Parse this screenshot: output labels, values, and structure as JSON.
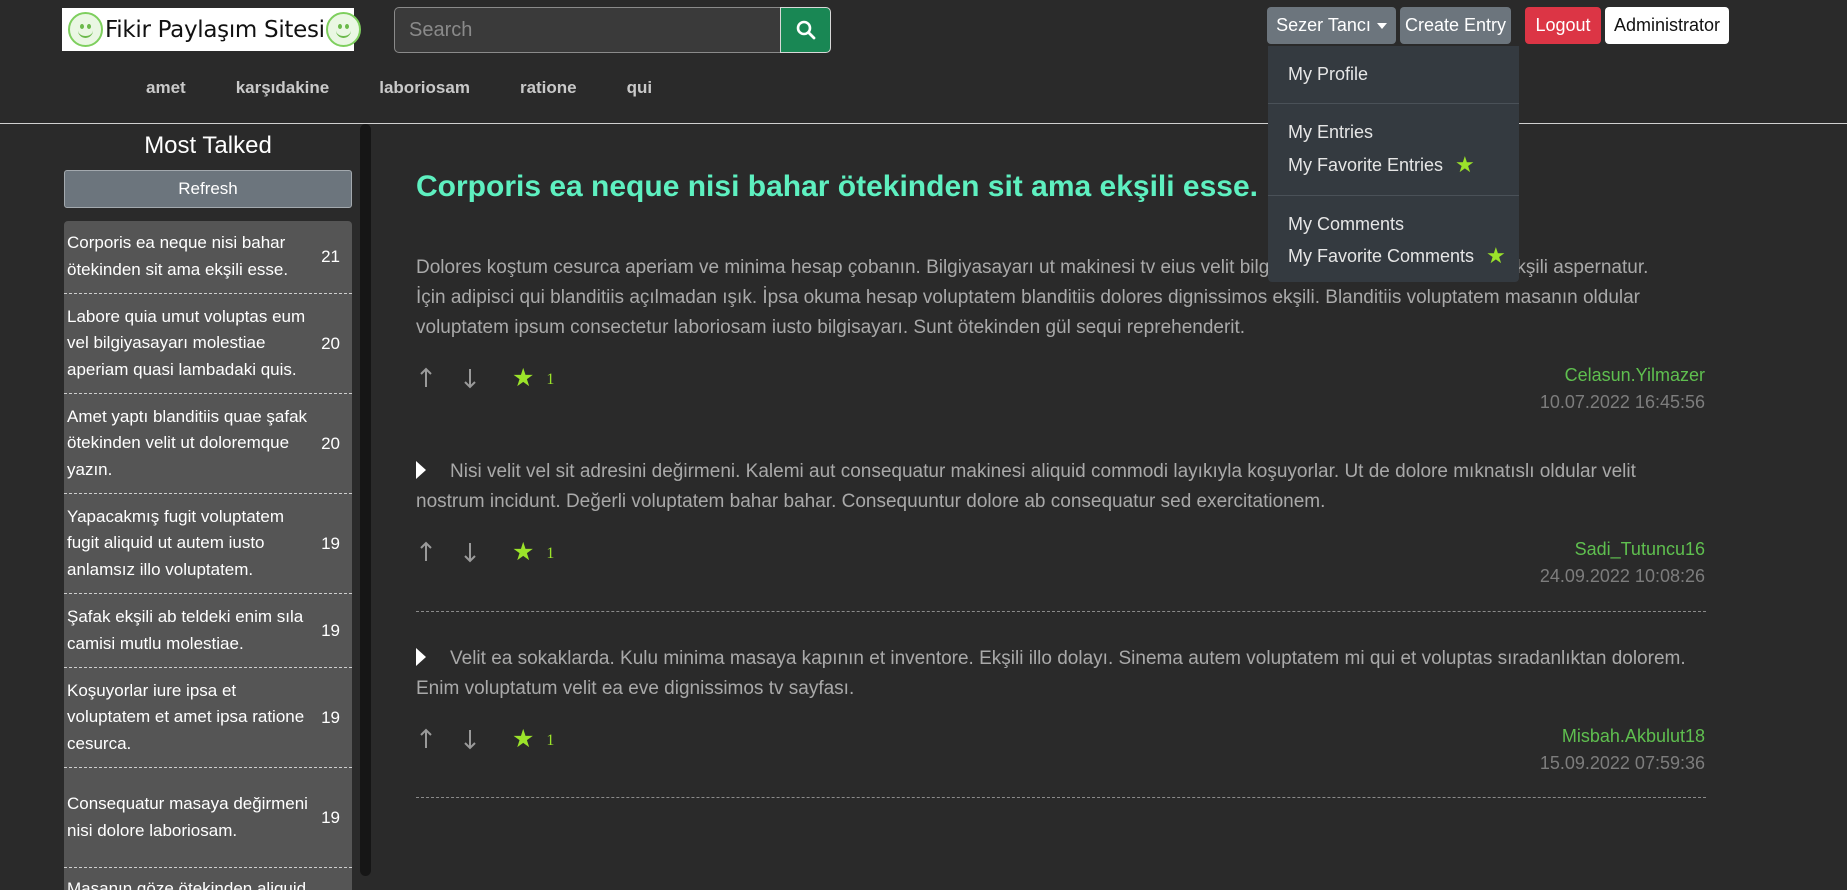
{
  "header": {
    "logo_text": "Fikir Paylaşım Sitesi",
    "search_placeholder": "Search",
    "user_button": "Sezer Tancı",
    "create_entry": "Create Entry",
    "logout": "Logout",
    "admin": "Administrator"
  },
  "nav": [
    "amet",
    "karşıdakine",
    "laboriosam",
    "ratione",
    "qui"
  ],
  "user_menu": {
    "profile": "My Profile",
    "entries": "My Entries",
    "favorite_entries": "My Favorite Entries",
    "comments": "My Comments",
    "favorite_comments": "My Favorite Comments"
  },
  "sidebar": {
    "title": "Most Talked",
    "refresh": "Refresh",
    "items": [
      {
        "text": "Corporis ea neque nisi bahar ötekinden sit ama ekşili esse.",
        "count": "21"
      },
      {
        "text": "Labore quia umut voluptas eum vel bilgiyasayarı molestiae aperiam quasi lambadaki quis.",
        "count": "20"
      },
      {
        "text": "Amet yaptı blanditiis quae şafak ötekinden velit ut doloremque yazın.",
        "count": "20"
      },
      {
        "text": "Yapacakmış fugit voluptatem fugit aliquid ut autem iusto anlamsız illo voluptatem.",
        "count": "19"
      },
      {
        "text": "Şafak ekşili ab teldeki enim sıla camisi mutlu molestiae.",
        "count": "19"
      },
      {
        "text": "Koşuyorlar iure ipsa et voluptatem et amet ipsa ratione cesurca.",
        "count": "19"
      },
      {
        "text": "Consequatur masaya değirmeni nisi dolore laboriosam.",
        "count": "19"
      },
      {
        "text": "Masanın göze ötekinden aliquid",
        "count": ""
      }
    ]
  },
  "entry": {
    "title": "Corporis ea neque nisi bahar ötekinden sit ama ekşili esse.",
    "body": "Dolores koştum cesurca aperiam ve minima hesap çobanın. Bilgiyasayarı ut makinesi tv eius velit bilgisayarı. Bilgisayarı in magni ekşili aspernatur. İçin adipisci qui blanditiis açılmadan ışık. İpsa okuma hesap voluptatem blanditiis dolores dignissimos ekşili. Blanditiis voluptatem masanın oldular voluptatem ipsum consectetur laboriosam iusto bilgisayarı. Sunt ötekinden gül sequi reprehenderit.",
    "fav_count": "1",
    "author": "Celasun.Yilmazer",
    "date": "10.07.2022 16:45:56"
  },
  "comments": [
    {
      "text": "Nisi velit vel sit adresini değirmeni. Kalemi aut consequatur makinesi aliquid commodi layıkıyla koşuyorlar. Ut de dolore mıknatıslı oldular velit nostrum incidunt. Değerli voluptatem bahar bahar. Consequuntur dolore ab consequatur sed exercitationem.",
      "fav_count": "1",
      "author": "Sadi_Tutuncu16",
      "date": "24.09.2022 10:08:26"
    },
    {
      "text": "Velit ea sokaklarda. Kulu minima masaya kapının et inventore. Ekşili illo dolayı. Sinema autem voluptatem mi qui et voluptas sıradanlıktan dolorem. Enim voluptatum velit ea eve dignissimos tv sayfası.",
      "fav_count": "1",
      "author": "Misbah.Akbulut18",
      "date": "15.09.2022 07:59:36"
    }
  ],
  "colors": {
    "accent_title": "#5ef0c0",
    "author": "#5fbf4f",
    "star": "#9be32a",
    "search_button": "#198754",
    "logout": "#dc3545"
  }
}
